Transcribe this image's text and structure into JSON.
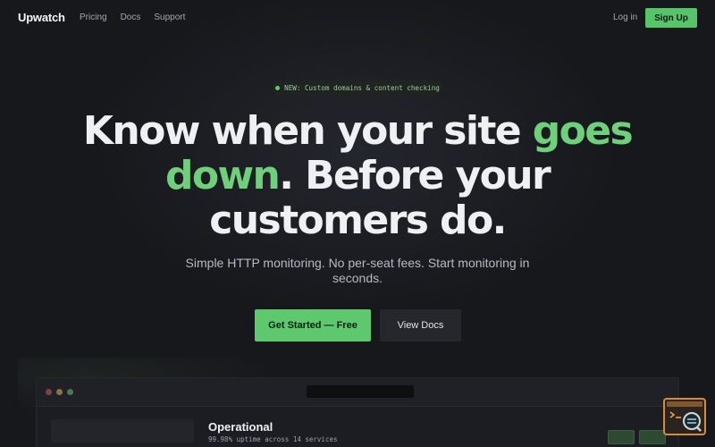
{
  "nav": {
    "logo": "Upwatch",
    "links": [
      "Pricing",
      "Docs",
      "Support"
    ],
    "login": "Log in",
    "signup": "Sign Up"
  },
  "badge": {
    "text": "NEW: Custom domains & content checking"
  },
  "hero": {
    "line1_a": "Know when your site ",
    "line1_b": "goes",
    "line2_a": "down",
    "line2_b": ". Before your",
    "line3": "customers do.",
    "subtitle": "Simple HTTP monitoring. No per-seat fees. Start monitoring in seconds.",
    "cta_primary": "Get Started — Free",
    "cta_secondary": "View Docs"
  },
  "preview": {
    "status_title": "Operational",
    "status_sub": "99.98% uptime across 14 services"
  },
  "colors": {
    "background": "#17181c",
    "accent": "#5ec86f",
    "widget_border": "#d98a3d"
  },
  "icons": {
    "window_controls": "traffic-light-dots",
    "widget": "terminal-search-icon"
  }
}
